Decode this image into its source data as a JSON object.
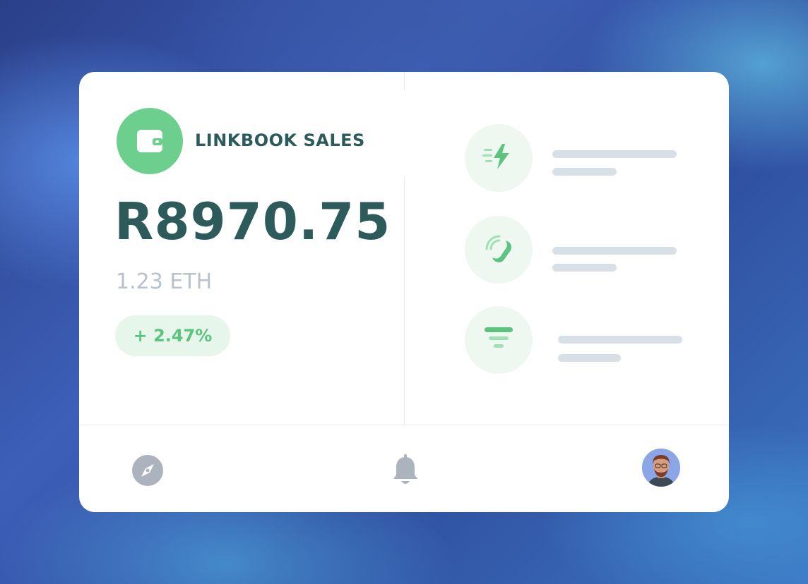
{
  "widget": {
    "title": "LINKBOOK SALES",
    "amount": "R8970.75",
    "eth_value": "1.23 ETH",
    "change": "+ 2.47%"
  },
  "actions": [
    {
      "icon": "lightning-icon"
    },
    {
      "icon": "phone-call-icon"
    },
    {
      "icon": "filter-icon"
    }
  ],
  "nav": {
    "items": [
      {
        "icon": "compass-icon"
      },
      {
        "icon": "bell-icon"
      },
      {
        "icon": "avatar"
      }
    ]
  },
  "colors": {
    "accent_green": "#6ccf8e",
    "text_dark": "#2d5b5c",
    "text_muted": "#b8c1cc",
    "pill_bg": "#e6f6ea",
    "icon_bg": "#eef8f1",
    "placeholder": "#d8dfe6"
  }
}
